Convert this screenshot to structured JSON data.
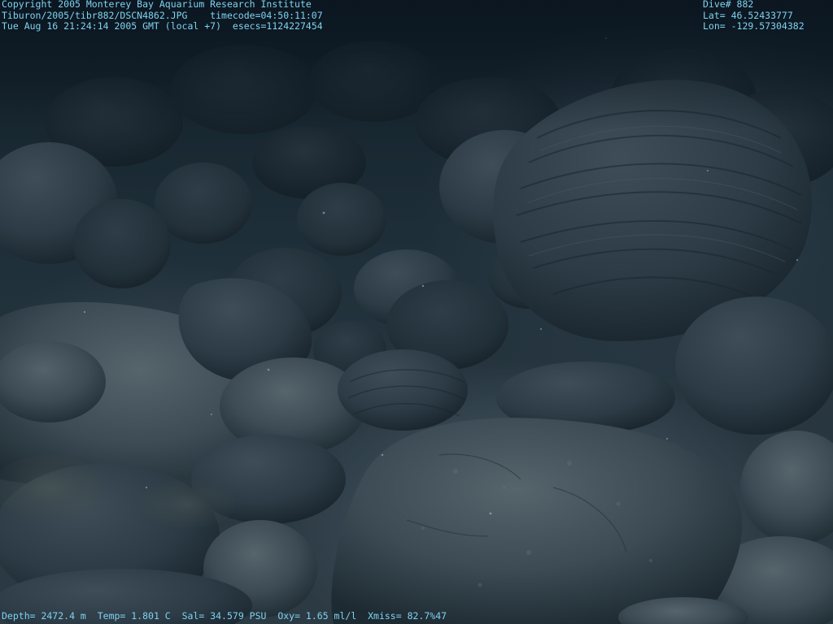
{
  "image": {
    "subject": "",
    "palette": {
      "water": "#0f1c26",
      "rock_dark": "#1c2a33",
      "rock_mid": "#2e3d47",
      "rock_light": "#55636b",
      "overlay_text": "#7fd3f2"
    }
  },
  "overlay": {
    "top_left": {
      "copyright": "Copyright 2005 Monterey Bay Aquarium Research Institute",
      "file_path": "Tiburon/2005/tibr882/DSCN4862.JPG",
      "timecode": "timecode=04:50:11:07",
      "datetime": "Tue Aug 16 21:24:14 2005 GMT (local +7)",
      "esecs": "esecs=1124227454"
    },
    "top_right": {
      "dive": "Dive# 882",
      "lat": "Lat= 46.52433777",
      "lon": "Lon= -129.57304382"
    },
    "bottom": {
      "depth": "Depth= 2472.4 m",
      "temp": "Temp= 1.801 C",
      "sal": "Sal= 34.579 PSU",
      "oxy": "Oxy= 1.65 ml/l",
      "xmiss": "Xmiss= 82.7%47"
    }
  }
}
